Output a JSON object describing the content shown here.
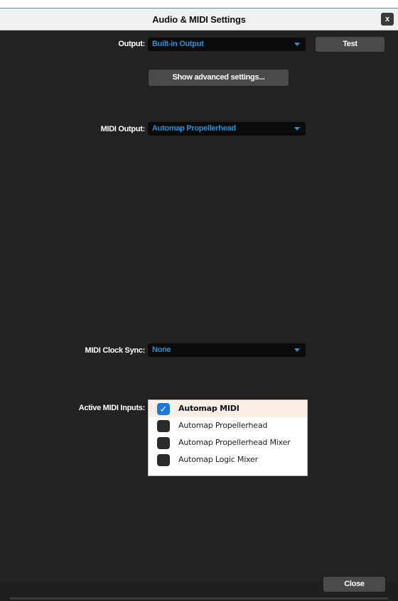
{
  "window": {
    "title": "Audio & MIDI Settings",
    "close_label": "x"
  },
  "output": {
    "label": "Output:",
    "value": "Built-in Output",
    "test_label": "Test"
  },
  "advanced_button": "Show advanced settings...",
  "midi_output": {
    "label": "MIDI Output:",
    "value": "Automap Propellerhead"
  },
  "midi_clock_sync": {
    "label": "MIDI Clock Sync:",
    "value": "None"
  },
  "active_midi_inputs": {
    "label": "Active MIDI Inputs:",
    "items": [
      {
        "label": "Automap MIDI",
        "checked": true
      },
      {
        "label": "Automap Propellerhead",
        "checked": false
      },
      {
        "label": "Automap Propellerhead Mixer",
        "checked": false
      },
      {
        "label": "Automap Logic Mixer",
        "checked": false
      }
    ]
  },
  "close_button": "Close",
  "colors": {
    "accent": "#2c8fd6",
    "background": "#222222",
    "button": "#4a4a4a",
    "selected_row": "#fbeee4"
  },
  "icons": {
    "combo_arrow": "chevron-down-icon",
    "checkmark": "checkmark-icon",
    "window_close": "close-icon"
  }
}
